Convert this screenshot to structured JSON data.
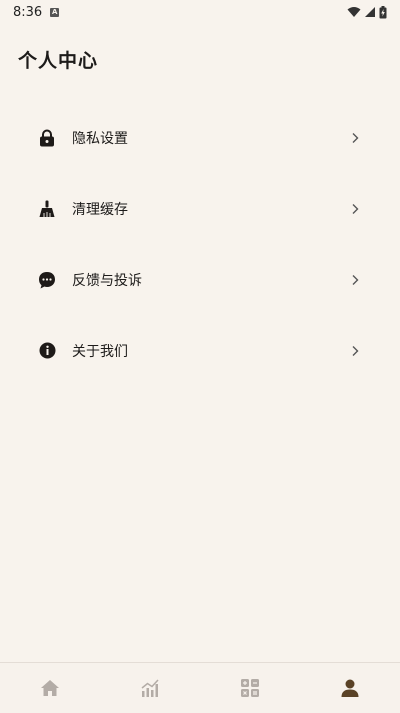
{
  "status_bar": {
    "time": "8:36",
    "notification_badge": "A",
    "icons": [
      "wifi-icon",
      "signal-icon",
      "battery-charging-icon"
    ]
  },
  "header": {
    "title": "个人中心"
  },
  "menu": {
    "items": [
      {
        "label": "隐私设置",
        "icon": "lock-icon"
      },
      {
        "label": "清理缓存",
        "icon": "broom-icon"
      },
      {
        "label": "反馈与投诉",
        "icon": "chat-bubble-icon"
      },
      {
        "label": "关于我们",
        "icon": "info-icon"
      }
    ],
    "chevron_icon": "chevron-right-icon"
  },
  "bottom_nav": {
    "tabs": [
      {
        "icon": "home-icon",
        "active": false
      },
      {
        "icon": "bar-chart-icon",
        "active": false
      },
      {
        "icon": "grid-calculator-icon",
        "active": false
      },
      {
        "icon": "user-icon",
        "active": true
      }
    ]
  },
  "colors": {
    "background": "#f8f3ed",
    "text": "#1d1b1a",
    "icon_dark": "#1e1a18",
    "nav_inactive": "#b3aca6",
    "nav_active": "#5a4226"
  }
}
